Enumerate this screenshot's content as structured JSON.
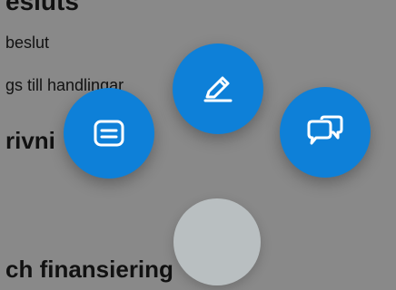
{
  "page": {
    "heading_top": "esluts",
    "line1": "beslut",
    "line2": "gs till handlingar",
    "heading_mid": "rivni",
    "heading_bottom": "ch finansiering"
  },
  "colors": {
    "fab_background": "#0e80d8",
    "overlay": "rgba(0,0,0,0.43)",
    "toggle_background": "#b9bfc1"
  },
  "fab_menu": {
    "actions": [
      {
        "icon": "message-square-icon"
      },
      {
        "icon": "pencil-edit-icon"
      },
      {
        "icon": "chat-bubbles-icon"
      }
    ],
    "toggle_icon": "circle"
  }
}
